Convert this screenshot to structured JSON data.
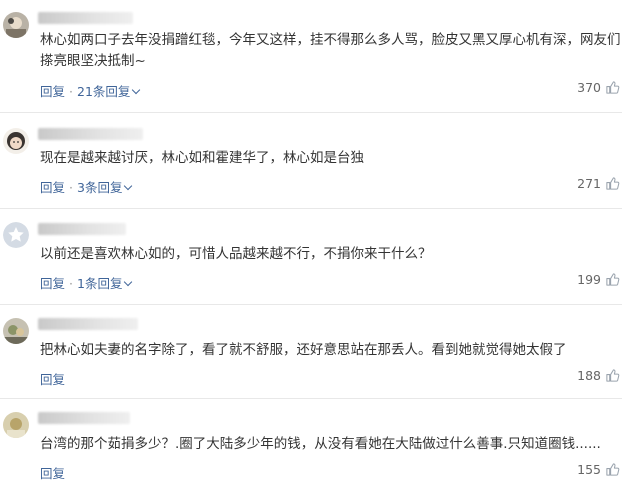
{
  "comments": [
    {
      "text": "林心如两口子去年没捐蹭红毯，今年又这样，挂不得那么多人骂，脸皮又黑又厚心机有深，网友们搽亮眼坚决抵制~",
      "reply_label": "回复",
      "replies_label": "21条回复",
      "likes": "370",
      "avatar": "avatar-photo"
    },
    {
      "text": "现在是越来越讨厌，林心如和霍建华了，林心如是台独",
      "reply_label": "回复",
      "replies_label": "3条回复",
      "likes": "271",
      "avatar": "avatar-photo"
    },
    {
      "text": "以前还是喜欢林心如的，可惜人品越来越不行，不捐你来干什么？",
      "reply_label": "回复",
      "replies_label": "1条回复",
      "likes": "199",
      "avatar": "default-star-avatar"
    },
    {
      "text": "把林心如夫妻的名字除了，看了就不舒服，还好意思站在那丢人。看到她就觉得她太假了",
      "reply_label": "回复",
      "replies_label": "",
      "likes": "188",
      "avatar": "avatar-photo"
    },
    {
      "text": "台湾的那个茹捐多少？.圈了大陆多少年的钱，从没有看她在大陆做过什么善事.只知道圈钱......",
      "reply_label": "回复",
      "replies_label": "",
      "likes": "155",
      "avatar": "avatar-photo"
    }
  ],
  "icons": {
    "like": "thumbs-up-icon",
    "expand": "chevron-down-icon"
  },
  "colors": {
    "link": "#406599",
    "text": "#333333",
    "count": "#666666"
  }
}
